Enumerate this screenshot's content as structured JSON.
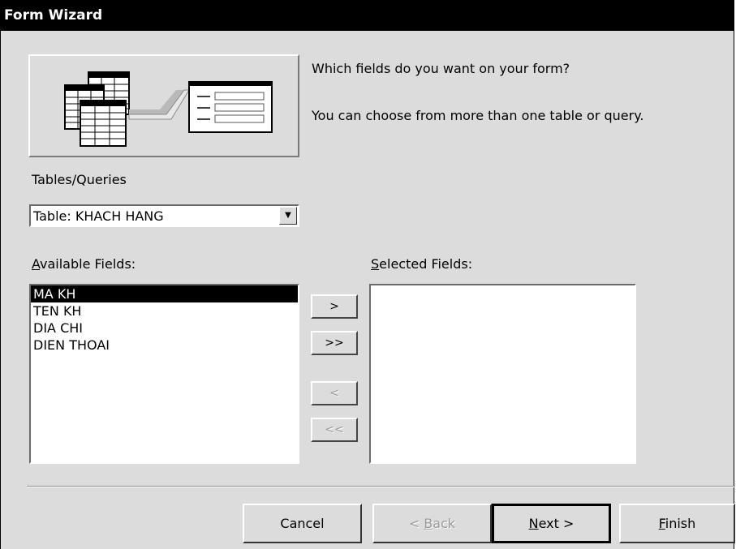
{
  "window": {
    "title": "Form Wizard"
  },
  "prompt": {
    "line1": "Which fields do you want on your form?",
    "line2": "You can choose from more than one table or query."
  },
  "tables_queries": {
    "label": "Tables/Queries",
    "selected": "Table: KHACH HANG"
  },
  "available_fields": {
    "label_mnemonic": "A",
    "label_rest": "vailable Fields:",
    "items": [
      "MA KH",
      "TEN KH",
      "DIA CHI",
      "DIEN THOAI"
    ],
    "selected_index": 0
  },
  "selected_fields": {
    "label_mnemonic": "S",
    "label_rest": "elected Fields:",
    "items": []
  },
  "move_buttons": {
    "add_one": ">",
    "add_all": ">>",
    "remove_one": "<",
    "remove_all": "<<"
  },
  "footer": {
    "cancel": "Cancel",
    "back_prefix": "< ",
    "back_mnemonic": "B",
    "back_rest": "ack",
    "next_mnemonic": "N",
    "next_rest": "ext >",
    "finish_mnemonic": "F",
    "finish_rest": "inish"
  },
  "icons": [
    "tables-illustration-icon",
    "form-illustration-icon",
    "dropdown-arrow-icon"
  ]
}
